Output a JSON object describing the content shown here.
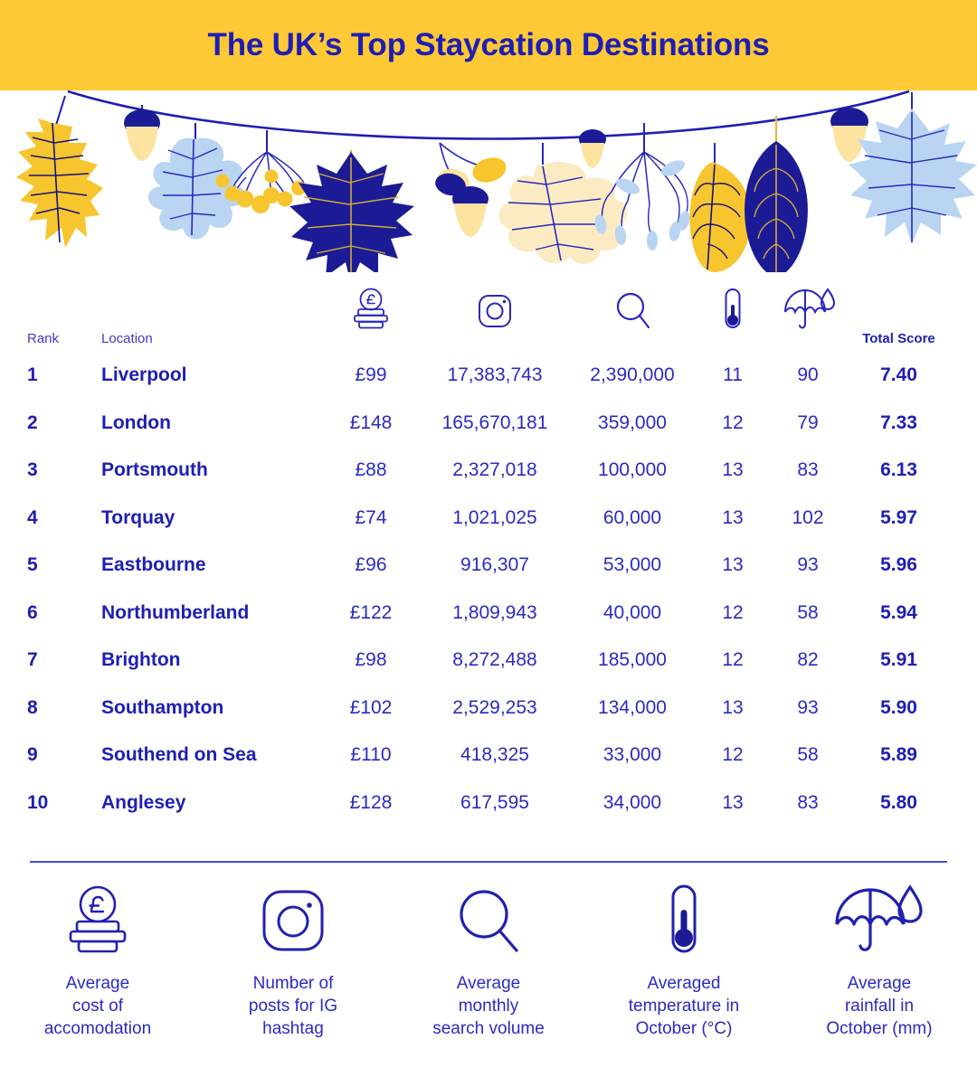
{
  "banner": {
    "title": "The UK’s Top Staycation Destinations"
  },
  "colors": {
    "banner_yellow": "#FFC935",
    "primary_blue": "#1E1EB4",
    "text_blue": "#2A2AC4",
    "light_blue": "#B9D5F2",
    "divider": "#4A4ADB"
  },
  "table": {
    "headers": {
      "rank": "Rank",
      "location": "Location",
      "cost_icon": "coin-stack-pound-icon",
      "ig_icon": "instagram-icon",
      "search_icon": "magnifier-icon",
      "temp_icon": "thermometer-icon",
      "rain_icon": "umbrella-raindrop-icon",
      "total_score": "Total Score"
    },
    "rows": [
      {
        "rank": "1",
        "location": "Liverpool",
        "cost": "£99",
        "ig": "17,383,743",
        "search": "2,390,000",
        "temp": "11",
        "rain": "90",
        "score": "7.40"
      },
      {
        "rank": "2",
        "location": "London",
        "cost": "£148",
        "ig": "165,670,181",
        "search": "359,000",
        "temp": "12",
        "rain": "79",
        "score": "7.33"
      },
      {
        "rank": "3",
        "location": "Portsmouth",
        "cost": "£88",
        "ig": "2,327,018",
        "search": "100,000",
        "temp": "13",
        "rain": "83",
        "score": "6.13"
      },
      {
        "rank": "4",
        "location": "Torquay",
        "cost": "£74",
        "ig": "1,021,025",
        "search": "60,000",
        "temp": "13",
        "rain": "102",
        "score": "5.97"
      },
      {
        "rank": "5",
        "location": "Eastbourne",
        "cost": "£96",
        "ig": "916,307",
        "search": "53,000",
        "temp": "13",
        "rain": "93",
        "score": "5.96"
      },
      {
        "rank": "6",
        "location": "Northumberland",
        "cost": "£122",
        "ig": "1,809,943",
        "search": "40,000",
        "temp": "12",
        "rain": "58",
        "score": "5.94"
      },
      {
        "rank": "7",
        "location": "Brighton",
        "cost": "£98",
        "ig": "8,272,488",
        "search": "185,000",
        "temp": "12",
        "rain": "82",
        "score": "5.91"
      },
      {
        "rank": "8",
        "location": "Southampton",
        "cost": "£102",
        "ig": "2,529,253",
        "search": "134,000",
        "temp": "13",
        "rain": "93",
        "score": "5.90"
      },
      {
        "rank": "9",
        "location": "Southend on Sea",
        "cost": "£110",
        "ig": "418,325",
        "search": "33,000",
        "temp": "12",
        "rain": "58",
        "score": "5.89"
      },
      {
        "rank": "10",
        "location": "Anglesey",
        "cost": "£128",
        "ig": "617,595",
        "search": "34,000",
        "temp": "13",
        "rain": "83",
        "score": "5.80"
      }
    ]
  },
  "legend": [
    {
      "icon": "coin-stack-pound-icon",
      "label": "Average\ncost of\naccomodation"
    },
    {
      "icon": "instagram-icon",
      "label": "Number of\nposts for IG\nhashtag"
    },
    {
      "icon": "magnifier-icon",
      "label": "Average\nmonthly\nsearch volume"
    },
    {
      "icon": "thermometer-icon",
      "label": "Averaged\ntemperature in\nOctober (°C)"
    },
    {
      "icon": "umbrella-raindrop-icon",
      "label": "Average\nrainfall in\nOctober (mm)"
    }
  ],
  "chart_data": {
    "type": "table",
    "title": "The UK’s Top Staycation Destinations",
    "columns": [
      "Rank",
      "Location",
      "Average cost of accomodation (£)",
      "Number of posts for IG hashtag",
      "Average monthly search volume",
      "Averaged temperature in October (°C)",
      "Average rainfall in October (mm)",
      "Total Score"
    ],
    "rows": [
      [
        "1",
        "Liverpool",
        99,
        17383743,
        2390000,
        11,
        90,
        7.4
      ],
      [
        "2",
        "London",
        148,
        165670181,
        359000,
        12,
        79,
        7.33
      ],
      [
        "3",
        "Portsmouth",
        88,
        2327018,
        100000,
        13,
        83,
        6.13
      ],
      [
        "4",
        "Torquay",
        74,
        1021025,
        60000,
        13,
        102,
        5.97
      ],
      [
        "5",
        "Eastbourne",
        96,
        916307,
        53000,
        13,
        93,
        5.96
      ],
      [
        "6",
        "Northumberland",
        122,
        1809943,
        40000,
        12,
        58,
        5.94
      ],
      [
        "7",
        "Brighton",
        98,
        8272488,
        185000,
        12,
        82,
        5.91
      ],
      [
        "8",
        "Southampton",
        102,
        2529253,
        134000,
        13,
        93,
        5.9
      ],
      [
        "9",
        "Southend on Sea",
        110,
        418325,
        33000,
        12,
        58,
        5.89
      ],
      [
        "10",
        "Anglesey",
        128,
        617595,
        34000,
        13,
        83,
        5.8
      ]
    ]
  }
}
